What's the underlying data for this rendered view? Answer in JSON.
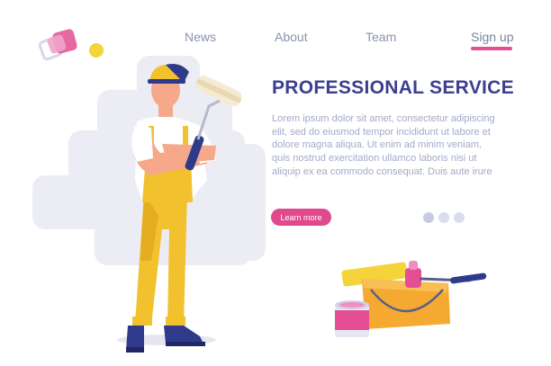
{
  "nav": {
    "items": [
      {
        "label": "News"
      },
      {
        "label": "About"
      },
      {
        "label": "Team"
      },
      {
        "label": "Sign up"
      }
    ]
  },
  "hero": {
    "title": "PROFESSIONAL SERVICE",
    "body": "Lorem ipsum dolor sit amet, consectetur adipiscing elit, sed do eiusmod tempor incididunt ut labore et dolore magna aliqua. Ut enim ad minim veniam, quis nostrud exercitation ullamco laboris nisi ut aliquip ex ea commodo consequat. Duis aute irure",
    "cta_label": "Learn more"
  },
  "carousel": {
    "active_index": 0,
    "count": 3
  },
  "colors": {
    "accent": "#e04a8c",
    "title": "#3a3f8f",
    "body_text": "#a3a9c9",
    "nav_text": "#8a93ad",
    "backdrop": "#ececf4"
  },
  "icons": [
    "logo-squares-icon",
    "painter-illustration",
    "paint-roller-icon",
    "paint-tray-icon",
    "paint-can-icon"
  ]
}
